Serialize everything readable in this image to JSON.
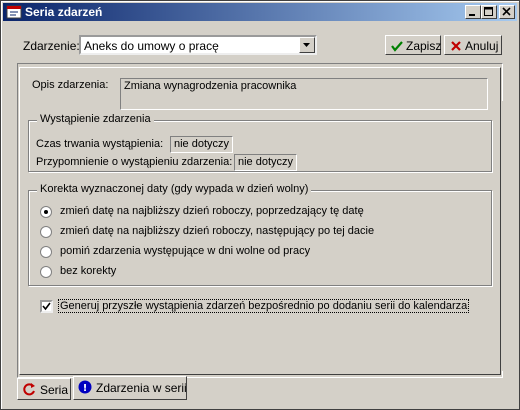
{
  "window": {
    "title": "Seria zdarzeń"
  },
  "toolbar": {
    "event_label": "Zdarzenie:",
    "event_value": "Aneks do umowy o pracę",
    "save_label": "Zapisz",
    "cancel_label": "Anuluj"
  },
  "details": {
    "description_label": "Opis zdarzenia:",
    "description_value": "Zmiana wynagrodzenia pracownika",
    "occurrence": {
      "legend": "Wystąpienie zdarzenia",
      "duration_label": "Czas trwania wystąpienia:",
      "duration_value": "nie dotyczy",
      "reminder_label": "Przypomnienie o wystąpieniu zdarzenia:",
      "reminder_value": "nie dotyczy"
    },
    "correction": {
      "legend": "Korekta wyznaczonej daty (gdy wypada w dzień wolny)",
      "options": [
        {
          "label": "zmień datę na najbliższy dzień roboczy, poprzedzający tę datę",
          "selected": true
        },
        {
          "label": "zmień datę na najbliższy dzień roboczy, następujący po tej dacie",
          "selected": false
        },
        {
          "label": "pomiń zdarzenia występujące w dni wolne od pracy",
          "selected": false
        },
        {
          "label": "bez korekty",
          "selected": false
        }
      ]
    },
    "generate_checkbox": {
      "label": "Generuj przyszłe wystąpienia zdarzeń bezpośrednio po dodaniu serii do kalendarza",
      "checked": true
    }
  },
  "tabs": [
    {
      "label": "Seria",
      "active": false,
      "icon": "undo-arrow-icon"
    },
    {
      "label": "Zdarzenia w serii",
      "active": true,
      "icon": "info-icon"
    }
  ],
  "colors": {
    "titlebar_start": "#0a246a",
    "titlebar_end": "#a6caf0",
    "face": "#d4d0c8",
    "save_check": "#008000",
    "cancel_x": "#c00000"
  }
}
